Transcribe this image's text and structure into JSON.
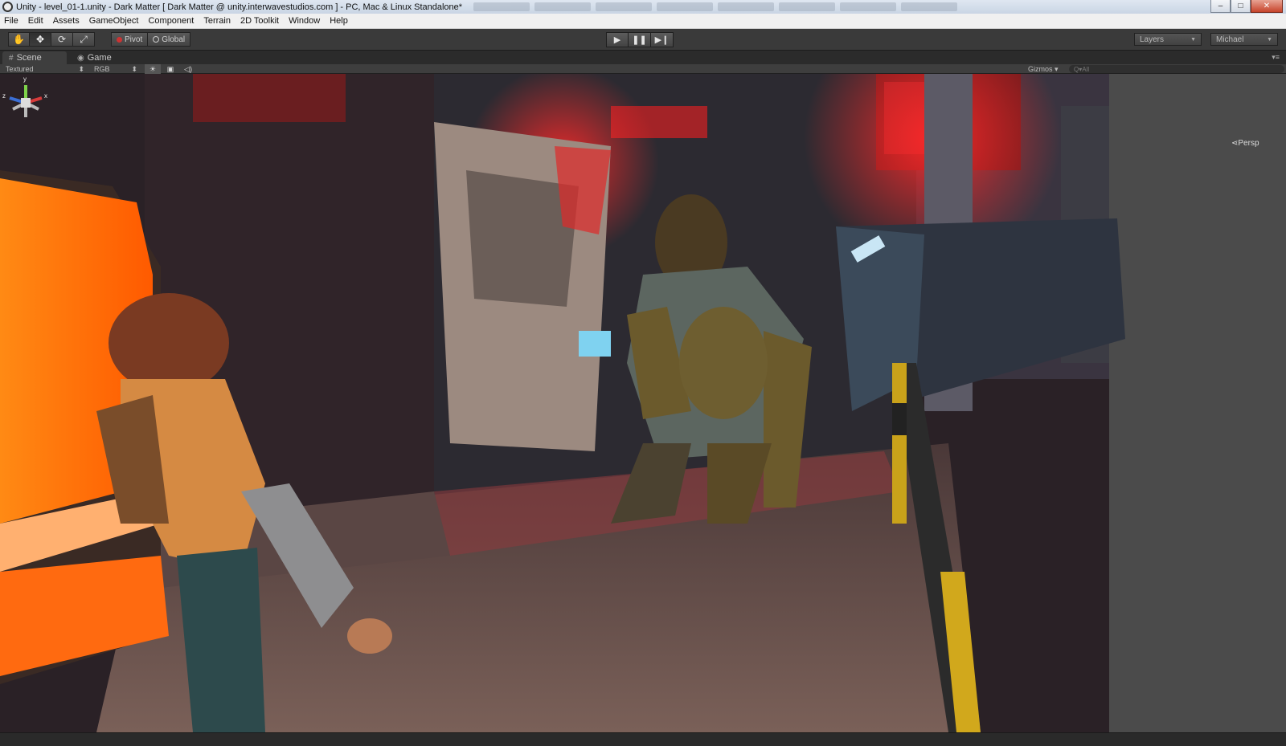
{
  "window": {
    "title": "Unity - level_01-1.unity - Dark Matter [ Dark Matter @ unity.interwavestudios.com ] - PC, Mac & Linux Standalone*",
    "buttons": {
      "minimize": "–",
      "maximize": "□",
      "close": "✕"
    }
  },
  "menu": {
    "items": [
      "File",
      "Edit",
      "Assets",
      "GameObject",
      "Component",
      "Terrain",
      "2D Toolkit",
      "Window",
      "Help"
    ]
  },
  "toolbar": {
    "transform_tools": [
      {
        "name": "hand-tool",
        "glyph": "✋"
      },
      {
        "name": "move-tool",
        "glyph": "✥"
      },
      {
        "name": "rotate-tool",
        "glyph": "⟳"
      },
      {
        "name": "scale-tool",
        "glyph": "⤢"
      }
    ],
    "pivot_label": "Pivot",
    "global_label": "Global",
    "play_glyph": "▶",
    "pause_glyph": "❚❚",
    "step_glyph": "▶❙",
    "layers_label": "Layers",
    "layout_label": "Michael"
  },
  "tabs": {
    "scene_label": "Scene",
    "game_label": "Game",
    "scene_icon": "#",
    "game_icon": "◉",
    "menu_glyph": "▾≡"
  },
  "scene_toolbar": {
    "render_mode": "Textured",
    "color_mode": "RGB",
    "gizmos_label": "Gizmos ▾",
    "search_placeholder": "Q▾All",
    "light_icon": "☀",
    "image_icon": "▣",
    "audio_icon": "◁)"
  },
  "viewport": {
    "gizmo_y": "y",
    "gizmo_x": "x",
    "gizmo_z": "z",
    "projection_label": "⋖Persp"
  }
}
